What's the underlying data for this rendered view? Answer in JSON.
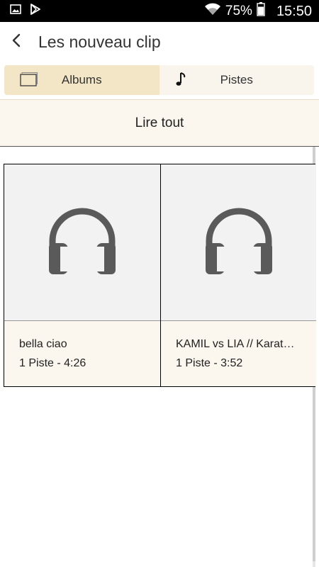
{
  "status_bar": {
    "icons": [
      "image-icon",
      "play-store-icon",
      "wifi-icon",
      "battery-icon"
    ],
    "battery": "75%",
    "time": "15:50"
  },
  "app_bar": {
    "back_icon": "back-arrow-icon",
    "title": "Les nouveau clip"
  },
  "tabs": [
    {
      "label": "Albums",
      "icon": "album-icon",
      "active": true
    },
    {
      "label": "Pistes",
      "icon": "music-note-icon",
      "active": false
    }
  ],
  "play_all_label": "Lire tout",
  "items": [
    {
      "title": "bella ciao",
      "meta": "1 Piste - 4:26",
      "icon": "headphones-icon"
    },
    {
      "title": "KAMIL vs LIA // Karat…",
      "meta": "1 Piste - 3:52",
      "icon": "headphones-icon"
    }
  ],
  "colors": {
    "active_tab": "#f3e6c6",
    "surface": "#fbf6ee",
    "icon_gray": "#5a5a5a"
  }
}
